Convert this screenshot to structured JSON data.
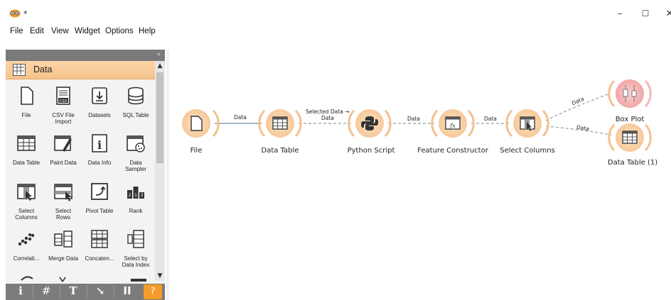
{
  "window": {
    "title": "*",
    "minimize": "–",
    "maximize": "☐",
    "close": "✕"
  },
  "menu": {
    "items": [
      "File",
      "Edit",
      "View",
      "Widget",
      "Options",
      "Help"
    ]
  },
  "category": {
    "label": "Data"
  },
  "widgets": [
    {
      "label": "File",
      "icon": "file-icon"
    },
    {
      "label": "CSV File\nImport",
      "icon": "csv-file-icon"
    },
    {
      "label": "Datasets",
      "icon": "datasets-icon"
    },
    {
      "label": "SQL Table",
      "icon": "database-icon"
    },
    {
      "label": "Data Table",
      "icon": "table-icon"
    },
    {
      "label": "Paint Data",
      "icon": "paint-data-icon"
    },
    {
      "label": "Data Info",
      "icon": "info-icon"
    },
    {
      "label": "Data\nSampler",
      "icon": "data-sampler-icon"
    },
    {
      "label": "Select\nColumns",
      "icon": "select-columns-icon"
    },
    {
      "label": "Select\nRows",
      "icon": "select-rows-icon"
    },
    {
      "label": "Pivot Table",
      "icon": "pivot-table-icon"
    },
    {
      "label": "Rank",
      "icon": "rank-icon"
    },
    {
      "label": "Correlati...",
      "icon": "correlations-icon"
    },
    {
      "label": "Merge Data",
      "icon": "merge-data-icon"
    },
    {
      "label": "Concaten...",
      "icon": "concatenate-icon"
    },
    {
      "label": "Select by\nData Index",
      "icon": "select-by-index-icon"
    }
  ],
  "bottom_bar": {
    "info": "i",
    "grid": "#",
    "text": "T",
    "arrow": "↘",
    "pause": "II",
    "help": "?"
  },
  "workflow": {
    "nodes": [
      {
        "id": "file",
        "label": "File",
        "icon": "file-icon"
      },
      {
        "id": "data-table",
        "label": "Data Table",
        "icon": "table-icon"
      },
      {
        "id": "python-script",
        "label": "Python Script",
        "icon": "python-icon"
      },
      {
        "id": "feature-constructor",
        "label": "Feature Constructor",
        "icon": "fx-icon"
      },
      {
        "id": "select-columns",
        "label": "Select Columns",
        "icon": "select-columns-icon"
      },
      {
        "id": "box-plot",
        "label": "Box Plot",
        "icon": "box-plot-icon"
      },
      {
        "id": "data-table-1",
        "label": "Data Table (1)",
        "icon": "table-icon"
      }
    ],
    "links": [
      {
        "label": "Data"
      },
      {
        "label": "Selected Data →",
        "label2": "Data"
      },
      {
        "label": "Data"
      },
      {
        "label": "Data"
      },
      {
        "label": "Data"
      },
      {
        "label": "Data"
      }
    ]
  },
  "colors": {
    "accent_orange": "#f6c38a",
    "node_ring": "#f6c89a",
    "box_plot_ring": "#f4a6a6",
    "help_orange": "#f39b2b"
  }
}
